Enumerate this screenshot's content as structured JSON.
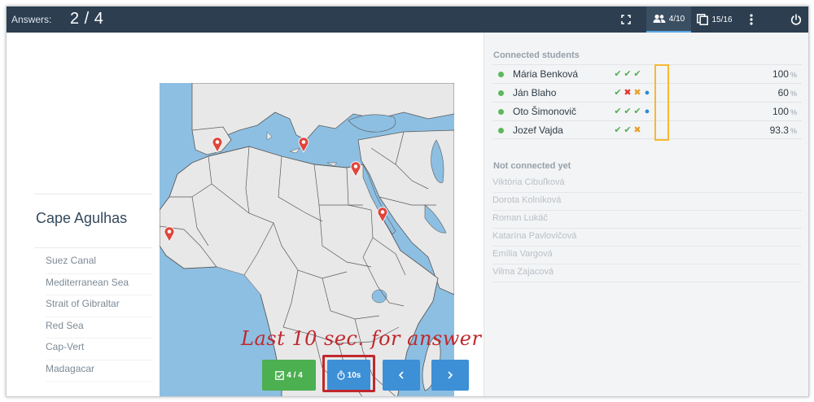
{
  "topbar": {
    "answers_label": "Answers:",
    "answers_count": "2 / 4",
    "students_count": "4/10",
    "questions_count": "15/16"
  },
  "question": {
    "title": "Cape Agulhas",
    "options": [
      "Suez Canal",
      "Mediterranean Sea",
      "Strait of Gibraltar",
      "Red Sea",
      "Cap-Vert",
      "Madagacar"
    ]
  },
  "buttons": {
    "ok_label": "4 / 4",
    "timer_label": "10s",
    "prev_icon": "chevron-left",
    "next_icon": "chevron-right"
  },
  "annotation": "Last 10 sec. for answer",
  "students": {
    "connected_title": "Connected students",
    "connected": [
      {
        "name": "Mária Benková",
        "marks": [
          "ok",
          "ok",
          "ok",
          ""
        ],
        "percent": "100"
      },
      {
        "name": "Ján Blaho",
        "marks": [
          "ok",
          "wrong",
          "partial",
          "pending"
        ],
        "percent": "60"
      },
      {
        "name": "Oto Šimonovič",
        "marks": [
          "ok",
          "ok",
          "ok",
          "pending"
        ],
        "percent": "100"
      },
      {
        "name": "Jozef Vajda",
        "marks": [
          "ok",
          "ok",
          "partial",
          ""
        ],
        "percent": "93.3"
      }
    ],
    "percent_unit": "%",
    "not_connected_title": "Not connected yet",
    "not_connected": [
      "Viktória Cibuľková",
      "Dorota Kolníková",
      "Roman Lukáč",
      "Katarína Pavlovičová",
      "Emília Vargová",
      "Vilma Zajacová"
    ]
  },
  "colors": {
    "topbar": "#2c3e50",
    "ok": "#4caf50",
    "wrong": "#e0312c",
    "partial": "#e5a02a",
    "pending": "#2a8ad8",
    "accent": "#3d8fd6",
    "annotation": "#c0282d",
    "column_highlight": "#f5b932",
    "marker": "#e0453a"
  }
}
